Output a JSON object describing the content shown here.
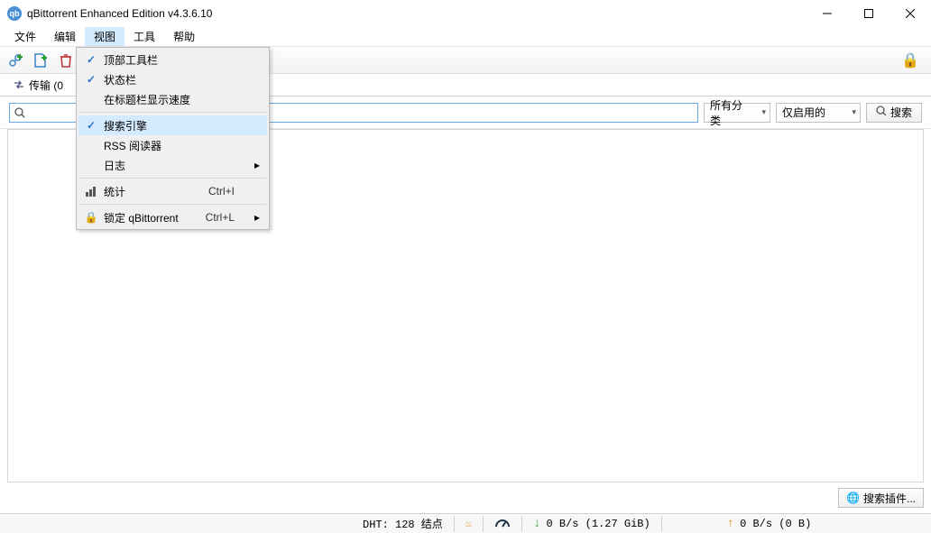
{
  "window": {
    "title": "qBittorrent Enhanced Edition v4.3.6.10",
    "app_icon_text": "qb"
  },
  "menubar": {
    "items": [
      "文件",
      "编辑",
      "视图",
      "工具",
      "帮助"
    ],
    "open_index": 2
  },
  "view_menu": {
    "items": [
      {
        "label": "顶部工具栏",
        "checked": true
      },
      {
        "label": "状态栏",
        "checked": true
      },
      {
        "label": "在标题栏显示速度",
        "checked": false
      },
      {
        "sep": true
      },
      {
        "label": "搜索引擎",
        "checked": true,
        "highlight": true
      },
      {
        "label": "RSS 阅读器",
        "checked": false
      },
      {
        "label": "日志",
        "submenu": true
      },
      {
        "sep": true
      },
      {
        "label": "统计",
        "icon": "stats",
        "shortcut": "Ctrl+I"
      },
      {
        "sep": true
      },
      {
        "label": "锁定 qBittorrent",
        "icon": "lock",
        "shortcut": "Ctrl+L",
        "submenu": true
      }
    ]
  },
  "tabs": {
    "transfers_label": "传输  (0"
  },
  "search": {
    "category_label": "所有分类",
    "engines_label": "仅启用的",
    "button_label": "搜索",
    "plugins_button": "搜索插件..."
  },
  "statusbar": {
    "dht": "DHT: 128 结点",
    "down": "0 B/s (1.27 GiB)",
    "up": "0 B/s (0 B)"
  }
}
